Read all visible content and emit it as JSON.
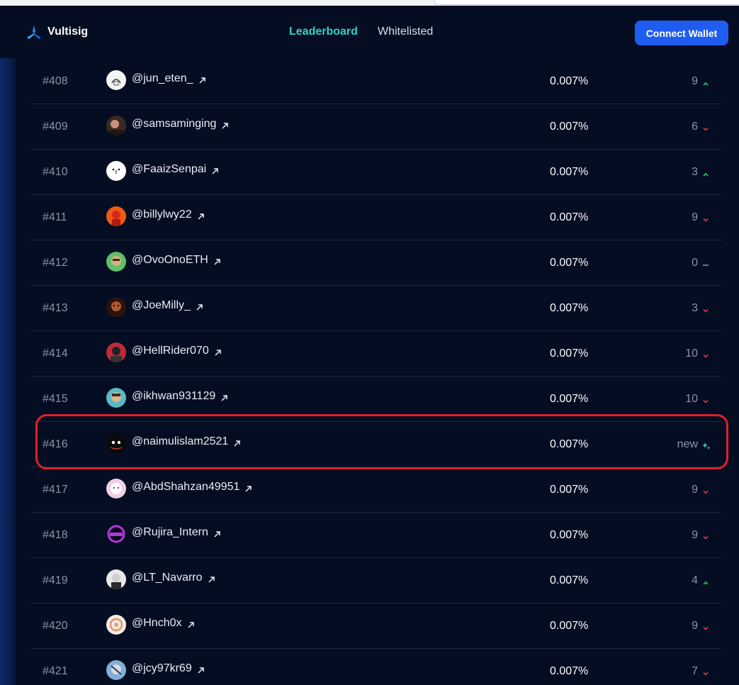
{
  "header": {
    "brand": "Vultisig",
    "tabs": [
      {
        "label": "Leaderboard",
        "active": true
      },
      {
        "label": "Whitelisted",
        "active": false
      }
    ],
    "connect_label": "Connect Wallet"
  },
  "colors": {
    "accent": "#33d1c6",
    "button": "#1f5df0",
    "up": "#2fc56f",
    "down": "#e0374a",
    "highlight": "#e0202a"
  },
  "rows": [
    {
      "rank": "#408",
      "user": "@jun_eten_",
      "share": "0.007%",
      "change": "9",
      "trend": "up",
      "avatar": "sketch"
    },
    {
      "rank": "#409",
      "user": "@samsaminging",
      "share": "0.007%",
      "change": "6",
      "trend": "down",
      "avatar": "photo"
    },
    {
      "rank": "#410",
      "user": "@FaaizSenpai",
      "share": "0.007%",
      "change": "3",
      "trend": "up",
      "avatar": "face"
    },
    {
      "rank": "#411",
      "user": "@billylwy22",
      "share": "0.007%",
      "change": "9",
      "trend": "down",
      "avatar": "orange"
    },
    {
      "rank": "#412",
      "user": "@OvoOnoETH",
      "share": "0.007%",
      "change": "0",
      "trend": "flat",
      "avatar": "green"
    },
    {
      "rank": "#413",
      "user": "@JoeMilly_",
      "share": "0.007%",
      "change": "3",
      "trend": "down",
      "avatar": "brown"
    },
    {
      "rank": "#414",
      "user": "@HellRider070",
      "share": "0.007%",
      "change": "10",
      "trend": "down",
      "avatar": "red"
    },
    {
      "rank": "#415",
      "user": "@ikhwan931129",
      "share": "0.007%",
      "change": "10",
      "trend": "down",
      "avatar": "teal"
    },
    {
      "rank": "#416",
      "user": "@naimulislam2521",
      "share": "0.007%",
      "change": "new",
      "trend": "new",
      "avatar": "dark"
    },
    {
      "rank": "#417",
      "user": "@AbdShahzan49951",
      "share": "0.007%",
      "change": "9",
      "trend": "down",
      "avatar": "pink"
    },
    {
      "rank": "#418",
      "user": "@Rujira_Intern",
      "share": "0.007%",
      "change": "9",
      "trend": "down",
      "avatar": "purple"
    },
    {
      "rank": "#419",
      "user": "@LT_Navarro",
      "share": "0.007%",
      "change": "4",
      "trend": "up",
      "avatar": "grey"
    },
    {
      "rank": "#420",
      "user": "@Hnch0x",
      "share": "0.007%",
      "change": "9",
      "trend": "down",
      "avatar": "ring"
    },
    {
      "rank": "#421",
      "user": "@jcy97kr69",
      "share": "0.007%",
      "change": "7",
      "trend": "down",
      "avatar": "blue"
    }
  ]
}
